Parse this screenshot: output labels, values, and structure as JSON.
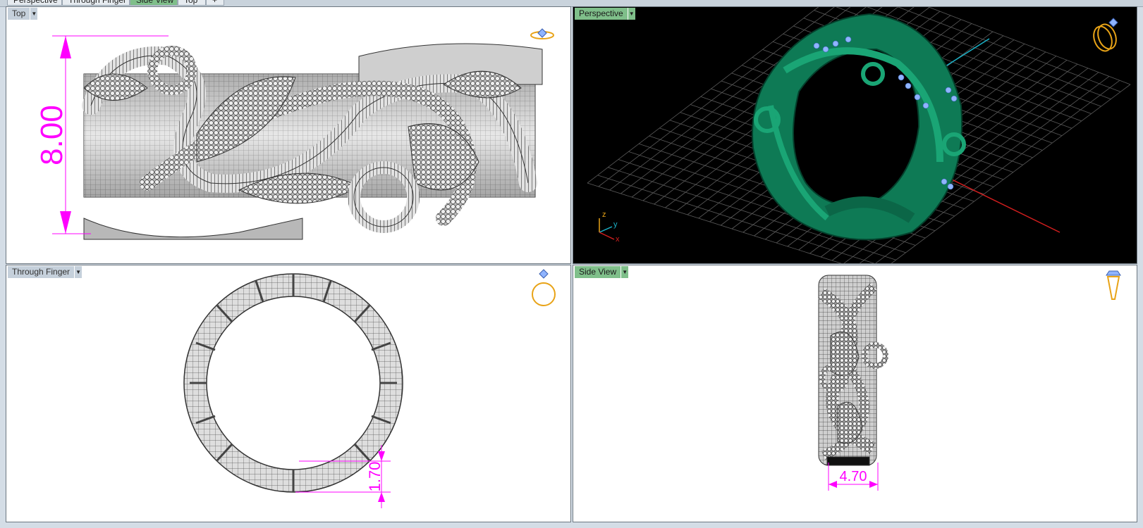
{
  "tabs": [
    {
      "label": "Perspective",
      "active": false
    },
    {
      "label": "Through Finger",
      "active": false
    },
    {
      "label": "Side View",
      "active": true
    },
    {
      "label": "Top",
      "active": false
    },
    {
      "label": "+",
      "active": false
    }
  ],
  "viewports": {
    "top": {
      "label": "Top",
      "dimension": "8.00",
      "widget_icon": "ring-top-widget-icon"
    },
    "perspective": {
      "label": "Perspective",
      "axis_z": "z",
      "axis_y": "y",
      "axis_x": "x",
      "widget_icon": "ring-perspective-widget-icon"
    },
    "through_finger": {
      "label": "Through Finger",
      "dimension": "1.70",
      "widget_icon": "ring-front-widget-icon"
    },
    "side_view": {
      "label": "Side View",
      "dimension": "4.70",
      "widget_icon": "ring-side-widget-icon"
    }
  },
  "colors": {
    "dimension": "#ff00ff",
    "model_green": "#0e7a55",
    "gem_blue": "#8fb4ff",
    "widget_gold": "#e8a317",
    "grid": "#5a5a5a",
    "axis_x": "#d21e1e",
    "axis_y": "#1bb3c9"
  }
}
